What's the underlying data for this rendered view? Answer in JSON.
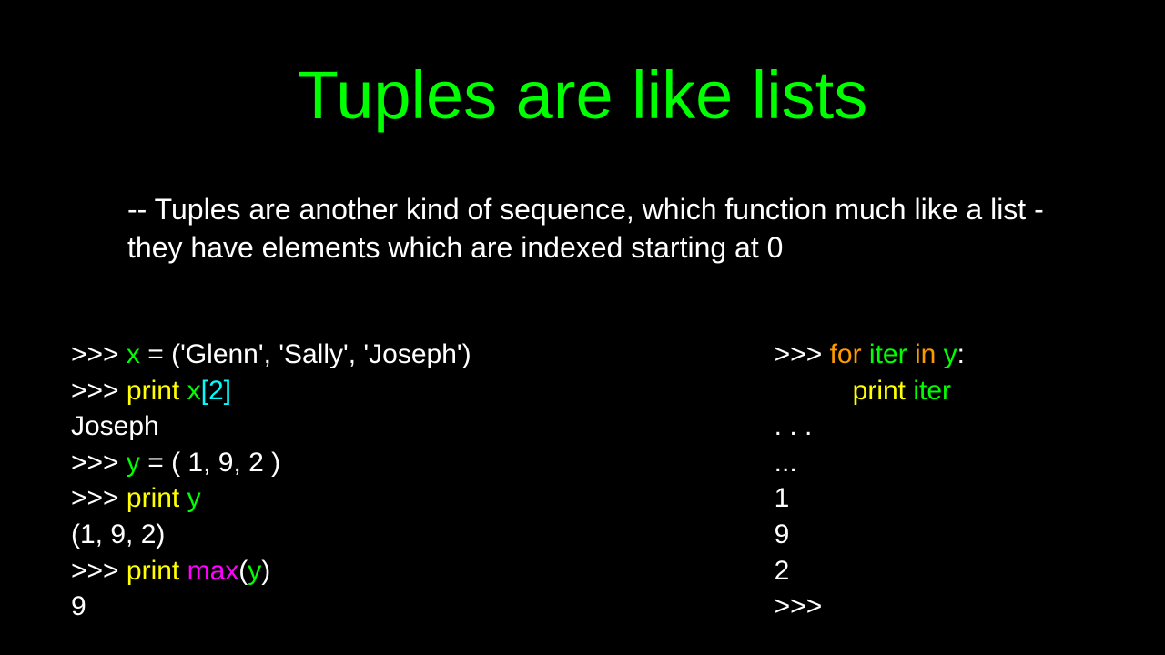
{
  "slide": {
    "title": "Tuples are like lists",
    "body": "-- Tuples are another kind of sequence, which function much like a list - they have elements which are indexed starting at 0"
  },
  "left": {
    "l1": {
      "p": ">>> ",
      "x": "x",
      "rest": " = ('Glenn', 'Sally', 'Joseph')"
    },
    "l2": {
      "p": ">>> ",
      "print": "print",
      "sp": " ",
      "x": "x",
      "br": "[2]"
    },
    "l3": "Joseph",
    "l4": {
      "p": ">>> ",
      "y": "y",
      "rest": " = ( 1, 9, 2 )"
    },
    "l5": {
      "p": ">>> ",
      "print": "print",
      "sp": " ",
      "y": "y"
    },
    "l6": "(1, 9, 2)",
    "l7": {
      "p": ">>> ",
      "print": "print",
      "sp": " ",
      "max": "max",
      "lp": "(",
      "y": "y",
      "rp": ")"
    },
    "l8": "9"
  },
  "right": {
    "l1": {
      "p": ">>> ",
      "for": "for",
      "sp1": " ",
      "iter": "iter",
      "sp2": " ",
      "in": "in",
      "sp3": " ",
      "y": "y",
      "colon": ":"
    },
    "l2": {
      "print": "print",
      "sp": " ",
      "iter": "iter"
    },
    "l3": " .  .  .",
    "l4": "...",
    "l5": "1",
    "l6": "9",
    "l7": "2",
    "l8": ">>>"
  }
}
